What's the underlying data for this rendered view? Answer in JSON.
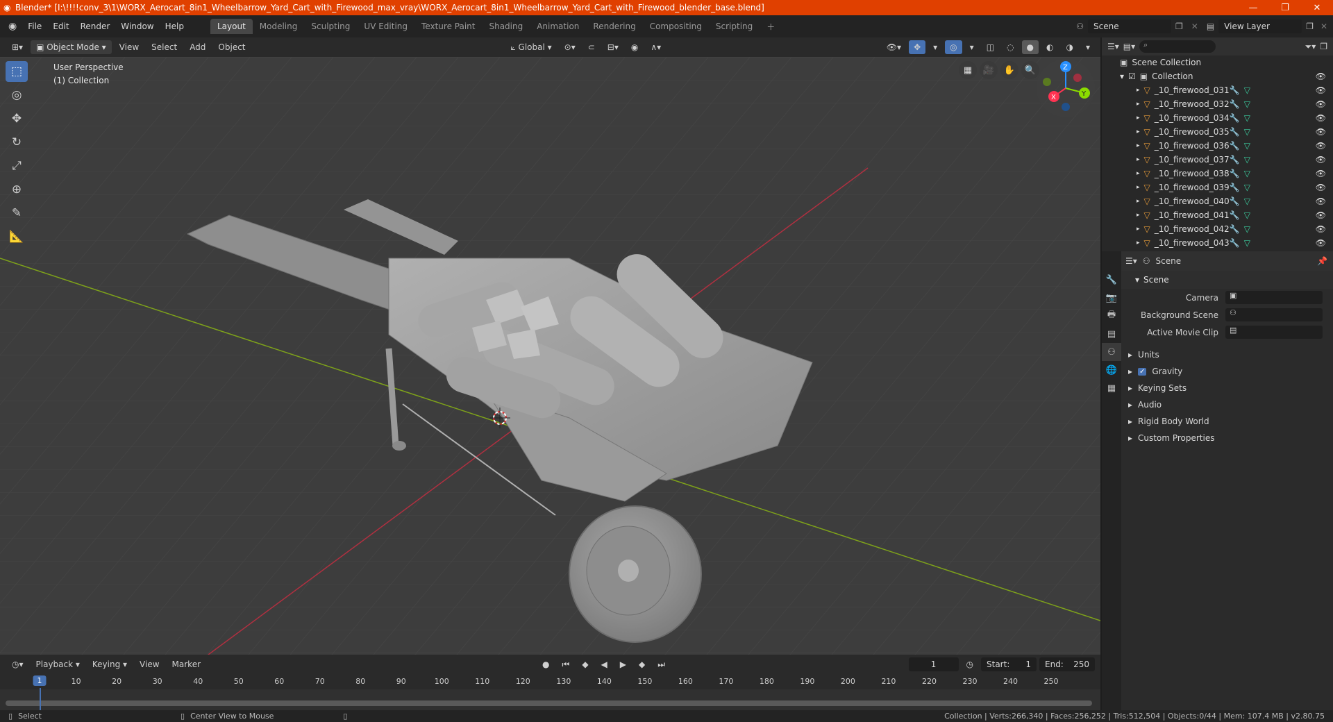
{
  "window": {
    "title": "Blender* [I:\\!!!!conv_3\\1\\WORX_Aerocart_8in1_Wheelbarrow_Yard_Cart_with_Firewood_max_vray\\WORX_Aerocart_8in1_Wheelbarrow_Yard_Cart_with_Firewood_blender_base.blend]",
    "minimize": "—",
    "maximize": "❐",
    "close": "✕"
  },
  "menu": [
    "File",
    "Edit",
    "Render",
    "Window",
    "Help"
  ],
  "workspaces": [
    "Layout",
    "Modeling",
    "Sculpting",
    "UV Editing",
    "Texture Paint",
    "Shading",
    "Animation",
    "Rendering",
    "Compositing",
    "Scripting"
  ],
  "scene": {
    "name": "Scene",
    "view_layer": "View Layer"
  },
  "viewport_header": {
    "mode": "Object Mode",
    "menus": [
      "View",
      "Select",
      "Add",
      "Object"
    ],
    "transform": "Global"
  },
  "viewport": {
    "view_name": "User Perspective",
    "collection": "(1) Collection"
  },
  "gizmo": {
    "x": "X",
    "y": "Y",
    "z": "Z"
  },
  "outliner": {
    "root": "Scene Collection",
    "collection": "Collection",
    "items": [
      "_10_firewood_031",
      "_10_firewood_032",
      "_10_firewood_034",
      "_10_firewood_035",
      "_10_firewood_036",
      "_10_firewood_037",
      "_10_firewood_038",
      "_10_firewood_039",
      "_10_firewood_040",
      "_10_firewood_041",
      "_10_firewood_042",
      "_10_firewood_043"
    ]
  },
  "properties": {
    "context": "Scene",
    "panel": "Scene",
    "fields": [
      {
        "label": "Camera"
      },
      {
        "label": "Background Scene"
      },
      {
        "label": "Active Movie Clip"
      }
    ],
    "sections": [
      "Units",
      "Gravity",
      "Keying Sets",
      "Audio",
      "Rigid Body World",
      "Custom Properties"
    ]
  },
  "timeline": {
    "menus": [
      "Playback",
      "Keying",
      "View",
      "Marker"
    ],
    "current_frame": "1",
    "start_label": "Start:",
    "start": "1",
    "end_label": "End:",
    "end": "250",
    "ticks": [
      "1",
      "10",
      "20",
      "30",
      "40",
      "50",
      "60",
      "70",
      "80",
      "90",
      "100",
      "110",
      "120",
      "130",
      "140",
      "150",
      "160",
      "170",
      "180",
      "190",
      "200",
      "210",
      "220",
      "230",
      "240",
      "250"
    ]
  },
  "statusbar": {
    "left": "Select",
    "middle": "Center View to Mouse",
    "right": "Collection | Verts:266,340 | Faces:256,252 | Tris:512,504 | Objects:0/44 | Mem: 107.4 MB | v2.80.75"
  },
  "colors": {
    "title_bar": "#e04000",
    "active_tool": "#4772b3",
    "x_axis": "#ff3352",
    "y_axis": "#8bdc00",
    "z_axis": "#2890ff",
    "mesh_icon": "#e59b3a",
    "data_icon": "#3ccfa0"
  }
}
